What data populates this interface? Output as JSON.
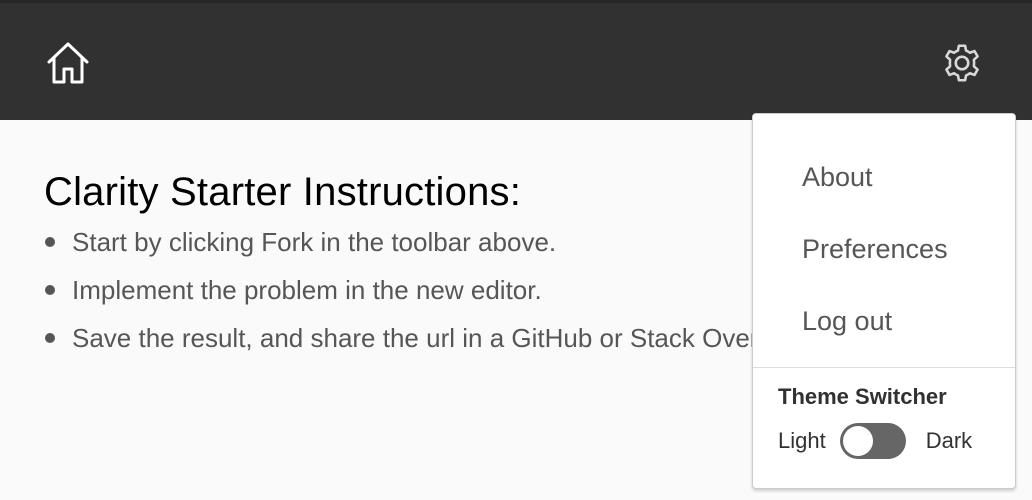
{
  "header": {
    "home_icon": "home-icon",
    "settings_icon": "gear-icon",
    "background_color": "#313131"
  },
  "main": {
    "title": "Clarity Starter Instructions:",
    "instructions": [
      "Start by clicking Fork in the toolbar above.",
      "Implement the problem in the new editor.",
      "Save the result, and share the url in a GitHub or Stack Overflow issue."
    ]
  },
  "dropdown": {
    "items": [
      {
        "label": "About"
      },
      {
        "label": "Preferences"
      },
      {
        "label": "Log out"
      }
    ],
    "theme_switcher": {
      "header": "Theme Switcher",
      "left_label": "Light",
      "right_label": "Dark",
      "state": "light"
    }
  }
}
